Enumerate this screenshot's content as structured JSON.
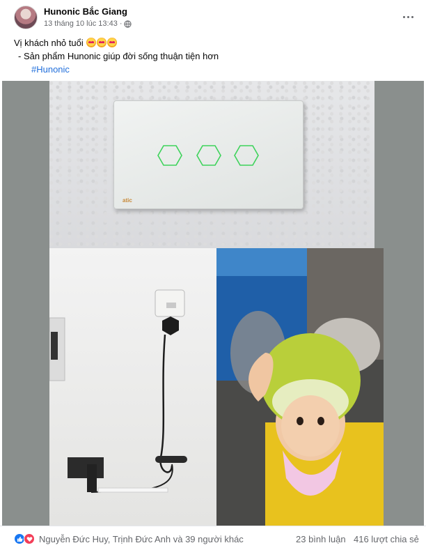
{
  "post": {
    "page_name": "Hunonic Bắc Giang",
    "timestamp": "13 tháng 10 lúc 13:43",
    "separator": "·",
    "privacy_icon": "globe-icon",
    "more_icon": "more-dots-icon",
    "caption_line1": "Vị khách nhỏ tuổi",
    "caption_line2": "- Sản phẩm Hunonic giúp đời sống thuận tiện hơn",
    "hashtag": "#Hunonic",
    "switch_brand": "atic"
  },
  "footer": {
    "reactors": "Nguyễn Đức Huy, Trịnh Đức Anh và 39 người khác",
    "comments": "23 bình luận",
    "shares": "416 lượt chia sẻ"
  },
  "colors": {
    "link": "#216fdb",
    "like": "#1877f2",
    "love": "#f33e58",
    "switch_glow": "#3dd35a"
  }
}
